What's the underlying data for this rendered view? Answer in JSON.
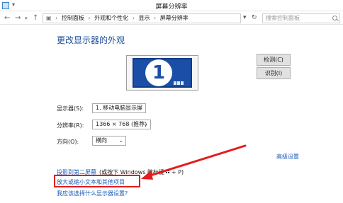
{
  "window": {
    "title": "屏幕分辨率"
  },
  "address": {
    "crumbs": [
      "控制面板",
      "外观和个性化",
      "显示",
      "屏幕分辨率"
    ],
    "search_placeholder": "搜索控制面板"
  },
  "main": {
    "heading": "更改显示器的外观",
    "monitor_number": "1",
    "detect_label": "检测(C)",
    "identify_label": "识别(I)",
    "display_label": "显示器(S):",
    "display_value": "1. 移动电脑显示屏",
    "resolution_label": "分辨率(R):",
    "resolution_value": "1366 × 768 (推荐)",
    "orientation_label": "方向(O):",
    "orientation_value": "横向",
    "advanced_link": "高级设置",
    "project_link": "投影到第二屏幕",
    "project_hint_pre": "(或按下 Windows 徽标键",
    "project_hint_post": "+ P)",
    "enlarge_link": "放大或缩小文本和其他项目",
    "which_link": "我应该选择什么显示器设置?"
  },
  "colors": {
    "link": "#1a5cb8",
    "highlight": "#e41c1c",
    "monitor": "#1b4fa7"
  }
}
